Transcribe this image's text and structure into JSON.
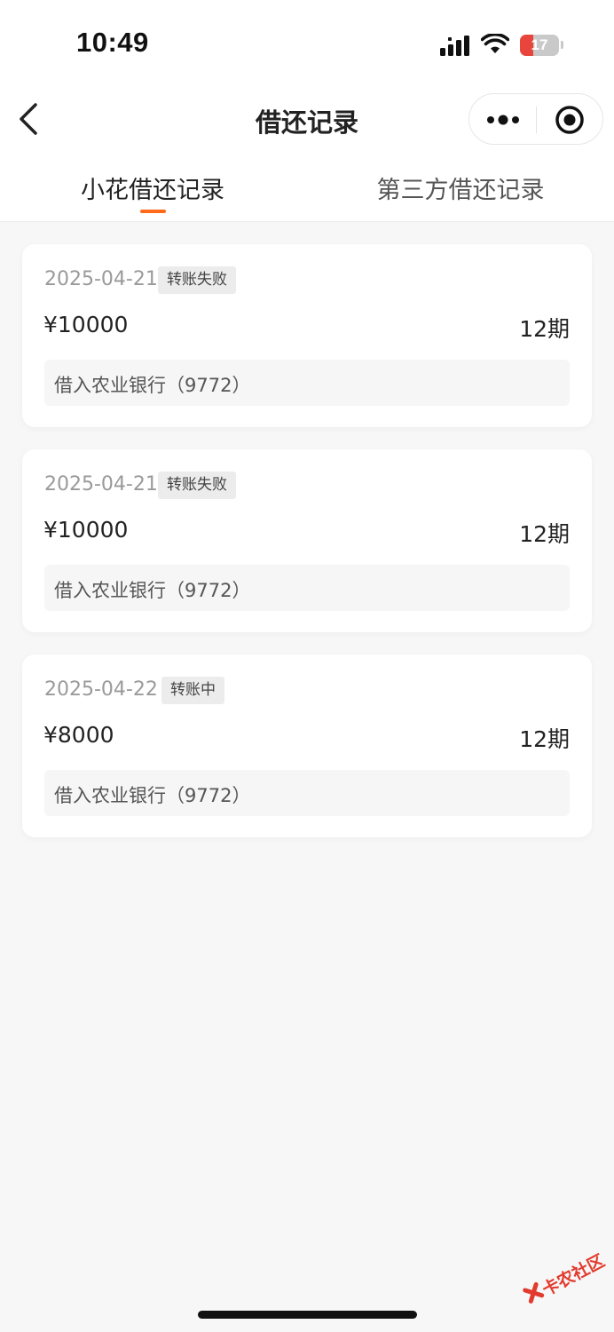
{
  "status_bar": {
    "time": "10:49",
    "battery_level": "17",
    "battery_color": "#e8453c"
  },
  "nav": {
    "title": "借还记录",
    "back_icon": "chevron-left-icon",
    "more_icon": "more-dots-icon",
    "close_icon": "target-circle-icon"
  },
  "tabs": [
    {
      "label": "小花借还记录",
      "active": true
    },
    {
      "label": "第三方借还记录",
      "active": false
    }
  ],
  "accent_color": "#ff6a1a",
  "records": [
    {
      "date": "2025-04-21",
      "status": "转账失败",
      "amount": "¥10000",
      "period": "12期",
      "desc": "借入农业银行（9772）"
    },
    {
      "date": "2025-04-21",
      "status": "转账失败",
      "amount": "¥10000",
      "period": "12期",
      "desc": "借入农业银行（9772）"
    },
    {
      "date": "2025-04-22",
      "status": "转账中",
      "amount": "¥8000",
      "period": "12期",
      "desc": "借入农业银行（9772）"
    }
  ],
  "watermark": {
    "text": "卡农社区",
    "icon": "kanong-logo-icon"
  }
}
